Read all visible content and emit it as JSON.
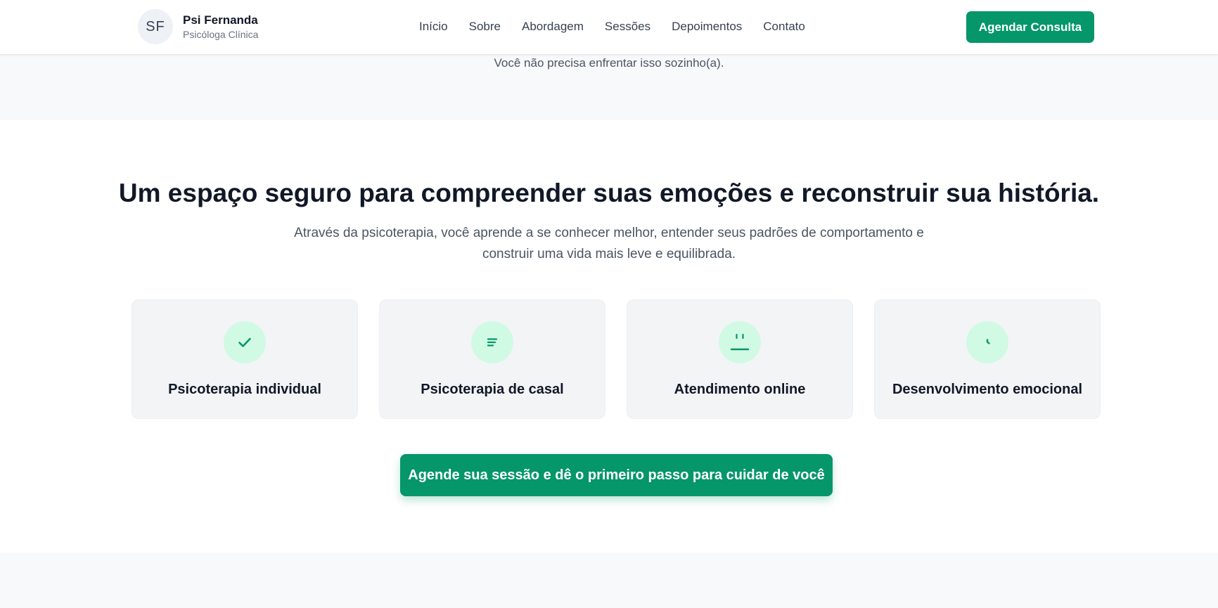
{
  "header": {
    "avatar_initials": "SF",
    "brand_name": "Psi Fernanda",
    "brand_role": "Psicóloga Clínica",
    "nav": [
      {
        "label": "Início"
      },
      {
        "label": "Sobre"
      },
      {
        "label": "Abordagem"
      },
      {
        "label": "Sessões"
      },
      {
        "label": "Depoimentos"
      },
      {
        "label": "Contato"
      }
    ],
    "cta_label": "Agendar Consulta"
  },
  "hero": {
    "tagline": "Você não precisa enfrentar isso sozinho(a)."
  },
  "main": {
    "headline": "Um espaço seguro para compreender suas emoções e reconstruir sua história.",
    "subtext": "Através da psicoterapia, você aprende a se conhecer melhor, entender seus padrões de comportamento e construir uma vida mais leve e equilibrada.",
    "cards": [
      {
        "title": "Psicoterapia individual",
        "icon": "check-icon"
      },
      {
        "title": "Psicoterapia de casal",
        "icon": "lines-icon"
      },
      {
        "title": "Atendimento online",
        "icon": "neutral-face-icon"
      },
      {
        "title": "Desenvolvimento emocional",
        "icon": "clock-icon"
      }
    ],
    "cta_label": "Agende sua sessão e dê o primeiro passo para cuidar de você"
  },
  "colors": {
    "accent": "#059669",
    "icon_bg": "#d1fae5",
    "card_bg": "#f3f4f6",
    "section_alt_bg": "#f8f9fb"
  }
}
